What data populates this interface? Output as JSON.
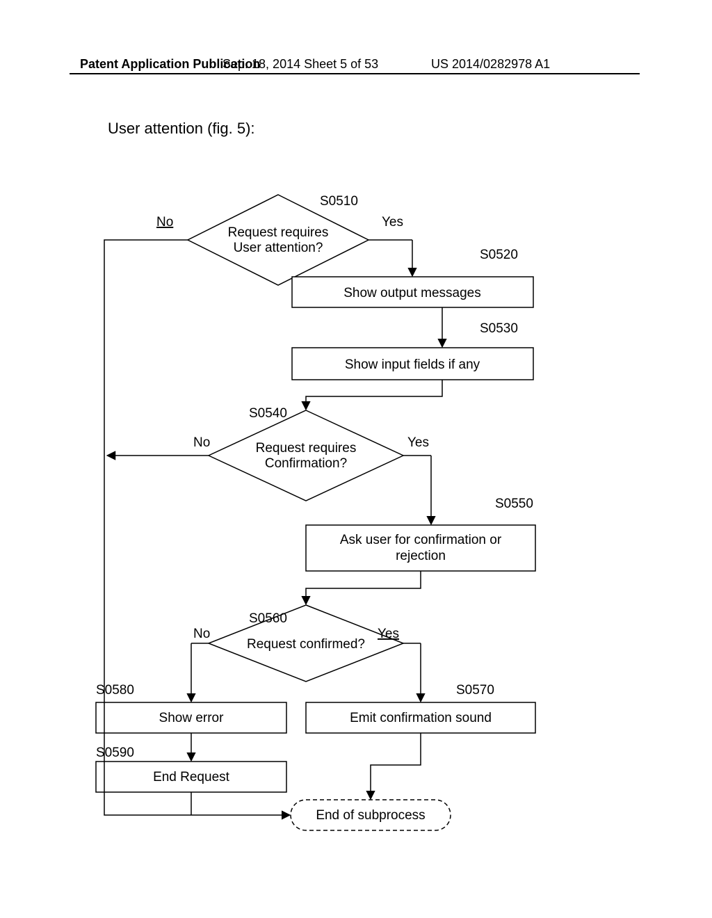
{
  "header": {
    "left": "Patent Application Publication",
    "mid": "Sep. 18, 2014  Sheet 5 of 53",
    "right": "US 2014/0282978 A1"
  },
  "title": "User attention (fig. 5):",
  "labels": {
    "yes": "Yes",
    "no": "No"
  },
  "refs": {
    "s0510": "S0510",
    "s0520": "S0520",
    "s0530": "S0530",
    "s0540": "S0540",
    "s0550": "S0550",
    "s0560": "S0560",
    "s0570": "S0570",
    "s0580": "S0580",
    "s0590": "S0590"
  },
  "nodes": {
    "d1a": "Request requires",
    "d1b": "User attention?",
    "p1": "Show output messages",
    "p2": "Show input fields if any",
    "d2a": "Request requires",
    "d2b": "Confirmation?",
    "p3a": "Ask user for confirmation or",
    "p3b": "rejection",
    "d3": "Request confirmed?",
    "p4": "Emit confirmation sound",
    "p5": "Show error",
    "p6": "End Request",
    "end": "End of subprocess"
  }
}
